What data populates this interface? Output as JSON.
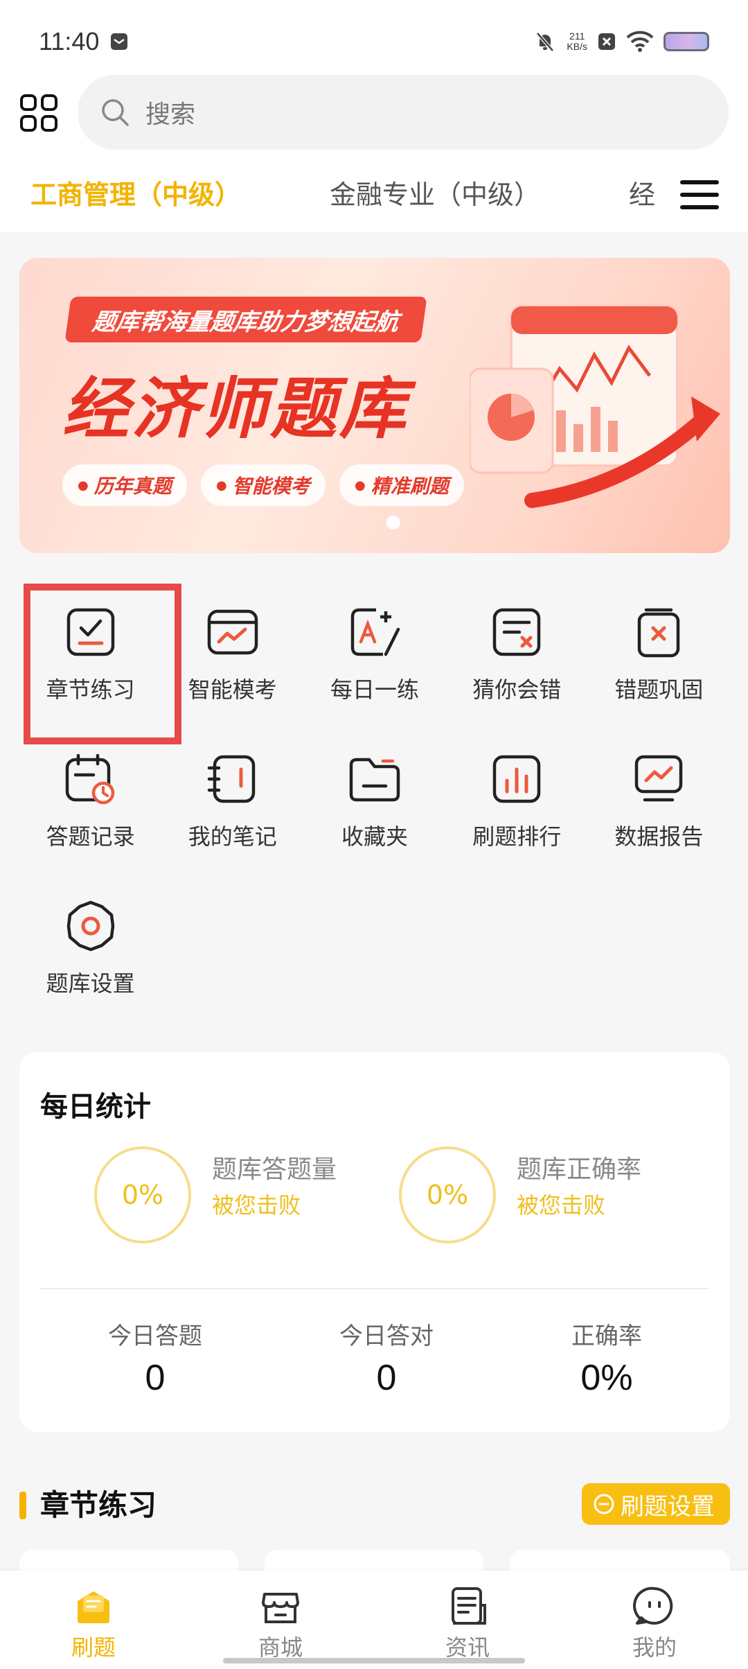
{
  "status": {
    "time": "11:40",
    "speed_value": "211",
    "speed_unit": "KB/s"
  },
  "search": {
    "placeholder": "搜索"
  },
  "tabs": [
    {
      "label": "工商管理（中级）"
    },
    {
      "label": "金融专业（中级）"
    },
    {
      "label": "经"
    }
  ],
  "banner": {
    "tagline": "题库帮海量题库助力梦想起航",
    "title": "经济师题库",
    "chips": [
      "历年真题",
      "智能模考",
      "精准刷题"
    ]
  },
  "grid": [
    {
      "label": "章节练习",
      "icon": "checklist-icon"
    },
    {
      "label": "智能模考",
      "icon": "mock-exam-icon"
    },
    {
      "label": "每日一练",
      "icon": "daily-practice-icon"
    },
    {
      "label": "猜你会错",
      "icon": "guess-wrong-icon"
    },
    {
      "label": "错题巩固",
      "icon": "wrong-review-icon"
    },
    {
      "label": "答题记录",
      "icon": "answer-record-icon"
    },
    {
      "label": "我的笔记",
      "icon": "notes-icon"
    },
    {
      "label": "收藏夹",
      "icon": "folder-icon"
    },
    {
      "label": "刷题排行",
      "icon": "ranking-icon"
    },
    {
      "label": "数据报告",
      "icon": "report-icon"
    },
    {
      "label": "题库设置",
      "icon": "settings-icon"
    }
  ],
  "stats": {
    "title": "每日统计",
    "items": [
      {
        "ring": "0%",
        "name": "题库答题量",
        "sub": "被您击败"
      },
      {
        "ring": "0%",
        "name": "题库正确率",
        "sub": "被您击败"
      }
    ],
    "today": [
      {
        "label": "今日答题",
        "value": "0"
      },
      {
        "label": "今日答对",
        "value": "0"
      },
      {
        "label": "正确率",
        "value": "0%"
      }
    ]
  },
  "section": {
    "title": "章节练习",
    "settings_label": "刷题设置"
  },
  "nav": [
    {
      "label": "刷题",
      "icon": "practice-icon",
      "active": true
    },
    {
      "label": "商城",
      "icon": "store-icon"
    },
    {
      "label": "资讯",
      "icon": "news-icon"
    },
    {
      "label": "我的",
      "icon": "profile-icon"
    }
  ],
  "colors": {
    "accent": "#f3b300",
    "banner_red": "#e63324",
    "highlight": "#e64a4a"
  }
}
